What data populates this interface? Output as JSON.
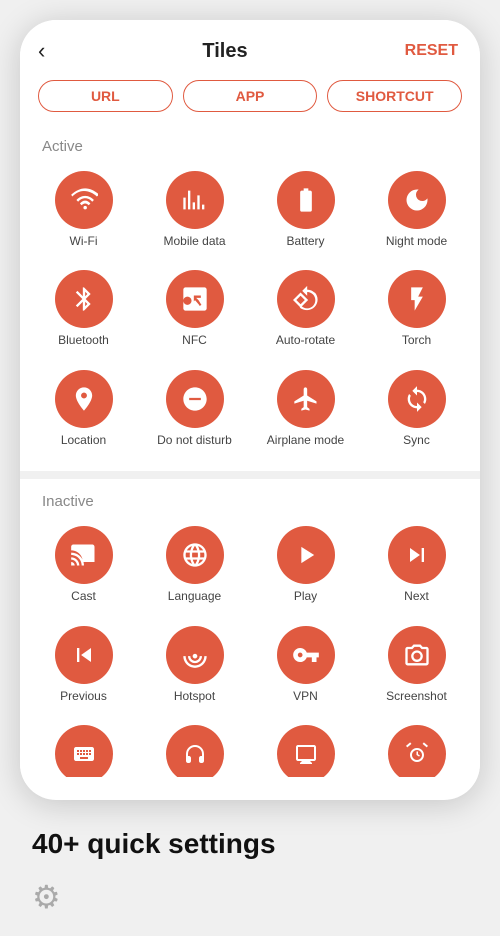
{
  "header": {
    "back_icon": "‹",
    "title": "Tiles",
    "reset_label": "RESET"
  },
  "tabs": [
    {
      "label": "URL",
      "active": false
    },
    {
      "label": "APP",
      "active": false
    },
    {
      "label": "SHORTCUT",
      "active": false
    }
  ],
  "active_section": {
    "label": "Active",
    "items": [
      {
        "id": "wifi",
        "label": "Wi-Fi",
        "icon": "wifi"
      },
      {
        "id": "mobile-data",
        "label": "Mobile data",
        "icon": "mobile"
      },
      {
        "id": "battery",
        "label": "Battery",
        "icon": "battery"
      },
      {
        "id": "night-mode",
        "label": "Night mode",
        "icon": "moon"
      },
      {
        "id": "bluetooth",
        "label": "Bluetooth",
        "icon": "bluetooth"
      },
      {
        "id": "nfc",
        "label": "NFC",
        "icon": "nfc"
      },
      {
        "id": "auto-rotate",
        "label": "Auto-rotate",
        "icon": "rotate"
      },
      {
        "id": "torch",
        "label": "Torch",
        "icon": "torch"
      },
      {
        "id": "location",
        "label": "Location",
        "icon": "location"
      },
      {
        "id": "do-not-disturb",
        "label": "Do not disturb",
        "icon": "dnd"
      },
      {
        "id": "airplane-mode",
        "label": "Airplane mode",
        "icon": "airplane"
      },
      {
        "id": "sync",
        "label": "Sync",
        "icon": "sync"
      }
    ]
  },
  "inactive_section": {
    "label": "Inactive",
    "items": [
      {
        "id": "cast",
        "label": "Cast",
        "icon": "cast"
      },
      {
        "id": "language",
        "label": "Language",
        "icon": "language"
      },
      {
        "id": "play",
        "label": "Play",
        "icon": "play"
      },
      {
        "id": "next",
        "label": "Next",
        "icon": "next"
      },
      {
        "id": "previous",
        "label": "Previous",
        "icon": "previous"
      },
      {
        "id": "hotspot",
        "label": "Hotspot",
        "icon": "hotspot"
      },
      {
        "id": "vpn",
        "label": "VPN",
        "icon": "vpn"
      },
      {
        "id": "screenshot",
        "label": "Screenshot",
        "icon": "screenshot"
      }
    ]
  },
  "partial_items": [
    {
      "id": "keyboard",
      "icon": "keyboard"
    },
    {
      "id": "headphone",
      "icon": "headphone"
    },
    {
      "id": "screen",
      "icon": "screen"
    },
    {
      "id": "alarm",
      "icon": "alarm"
    }
  ],
  "bottom": {
    "title": "40+ quick settings",
    "gear_icon": "⚙"
  },
  "colors": {
    "accent": "#e05a40",
    "text_primary": "#222",
    "text_secondary": "#888",
    "bg": "#f0f0f0"
  }
}
